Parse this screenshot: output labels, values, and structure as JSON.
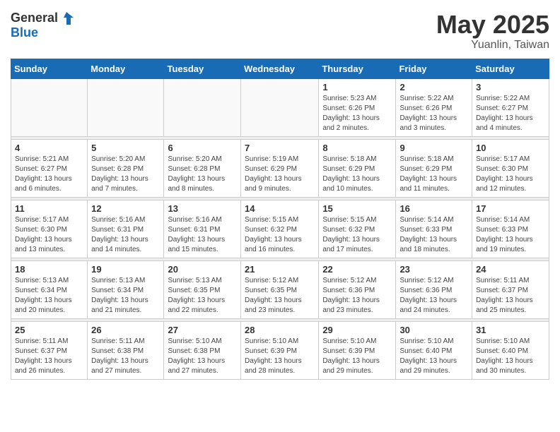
{
  "header": {
    "logo_general": "General",
    "logo_blue": "Blue",
    "month": "May 2025",
    "location": "Yuanlin, Taiwan"
  },
  "weekdays": [
    "Sunday",
    "Monday",
    "Tuesday",
    "Wednesday",
    "Thursday",
    "Friday",
    "Saturday"
  ],
  "weeks": [
    [
      {
        "day": "",
        "info": ""
      },
      {
        "day": "",
        "info": ""
      },
      {
        "day": "",
        "info": ""
      },
      {
        "day": "",
        "info": ""
      },
      {
        "day": "1",
        "info": "Sunrise: 5:23 AM\nSunset: 6:26 PM\nDaylight: 13 hours\nand 2 minutes."
      },
      {
        "day": "2",
        "info": "Sunrise: 5:22 AM\nSunset: 6:26 PM\nDaylight: 13 hours\nand 3 minutes."
      },
      {
        "day": "3",
        "info": "Sunrise: 5:22 AM\nSunset: 6:27 PM\nDaylight: 13 hours\nand 4 minutes."
      }
    ],
    [
      {
        "day": "4",
        "info": "Sunrise: 5:21 AM\nSunset: 6:27 PM\nDaylight: 13 hours\nand 6 minutes."
      },
      {
        "day": "5",
        "info": "Sunrise: 5:20 AM\nSunset: 6:28 PM\nDaylight: 13 hours\nand 7 minutes."
      },
      {
        "day": "6",
        "info": "Sunrise: 5:20 AM\nSunset: 6:28 PM\nDaylight: 13 hours\nand 8 minutes."
      },
      {
        "day": "7",
        "info": "Sunrise: 5:19 AM\nSunset: 6:29 PM\nDaylight: 13 hours\nand 9 minutes."
      },
      {
        "day": "8",
        "info": "Sunrise: 5:18 AM\nSunset: 6:29 PM\nDaylight: 13 hours\nand 10 minutes."
      },
      {
        "day": "9",
        "info": "Sunrise: 5:18 AM\nSunset: 6:29 PM\nDaylight: 13 hours\nand 11 minutes."
      },
      {
        "day": "10",
        "info": "Sunrise: 5:17 AM\nSunset: 6:30 PM\nDaylight: 13 hours\nand 12 minutes."
      }
    ],
    [
      {
        "day": "11",
        "info": "Sunrise: 5:17 AM\nSunset: 6:30 PM\nDaylight: 13 hours\nand 13 minutes."
      },
      {
        "day": "12",
        "info": "Sunrise: 5:16 AM\nSunset: 6:31 PM\nDaylight: 13 hours\nand 14 minutes."
      },
      {
        "day": "13",
        "info": "Sunrise: 5:16 AM\nSunset: 6:31 PM\nDaylight: 13 hours\nand 15 minutes."
      },
      {
        "day": "14",
        "info": "Sunrise: 5:15 AM\nSunset: 6:32 PM\nDaylight: 13 hours\nand 16 minutes."
      },
      {
        "day": "15",
        "info": "Sunrise: 5:15 AM\nSunset: 6:32 PM\nDaylight: 13 hours\nand 17 minutes."
      },
      {
        "day": "16",
        "info": "Sunrise: 5:14 AM\nSunset: 6:33 PM\nDaylight: 13 hours\nand 18 minutes."
      },
      {
        "day": "17",
        "info": "Sunrise: 5:14 AM\nSunset: 6:33 PM\nDaylight: 13 hours\nand 19 minutes."
      }
    ],
    [
      {
        "day": "18",
        "info": "Sunrise: 5:13 AM\nSunset: 6:34 PM\nDaylight: 13 hours\nand 20 minutes."
      },
      {
        "day": "19",
        "info": "Sunrise: 5:13 AM\nSunset: 6:34 PM\nDaylight: 13 hours\nand 21 minutes."
      },
      {
        "day": "20",
        "info": "Sunrise: 5:13 AM\nSunset: 6:35 PM\nDaylight: 13 hours\nand 22 minutes."
      },
      {
        "day": "21",
        "info": "Sunrise: 5:12 AM\nSunset: 6:35 PM\nDaylight: 13 hours\nand 23 minutes."
      },
      {
        "day": "22",
        "info": "Sunrise: 5:12 AM\nSunset: 6:36 PM\nDaylight: 13 hours\nand 23 minutes."
      },
      {
        "day": "23",
        "info": "Sunrise: 5:12 AM\nSunset: 6:36 PM\nDaylight: 13 hours\nand 24 minutes."
      },
      {
        "day": "24",
        "info": "Sunrise: 5:11 AM\nSunset: 6:37 PM\nDaylight: 13 hours\nand 25 minutes."
      }
    ],
    [
      {
        "day": "25",
        "info": "Sunrise: 5:11 AM\nSunset: 6:37 PM\nDaylight: 13 hours\nand 26 minutes."
      },
      {
        "day": "26",
        "info": "Sunrise: 5:11 AM\nSunset: 6:38 PM\nDaylight: 13 hours\nand 27 minutes."
      },
      {
        "day": "27",
        "info": "Sunrise: 5:10 AM\nSunset: 6:38 PM\nDaylight: 13 hours\nand 27 minutes."
      },
      {
        "day": "28",
        "info": "Sunrise: 5:10 AM\nSunset: 6:39 PM\nDaylight: 13 hours\nand 28 minutes."
      },
      {
        "day": "29",
        "info": "Sunrise: 5:10 AM\nSunset: 6:39 PM\nDaylight: 13 hours\nand 29 minutes."
      },
      {
        "day": "30",
        "info": "Sunrise: 5:10 AM\nSunset: 6:40 PM\nDaylight: 13 hours\nand 29 minutes."
      },
      {
        "day": "31",
        "info": "Sunrise: 5:10 AM\nSunset: 6:40 PM\nDaylight: 13 hours\nand 30 minutes."
      }
    ]
  ]
}
